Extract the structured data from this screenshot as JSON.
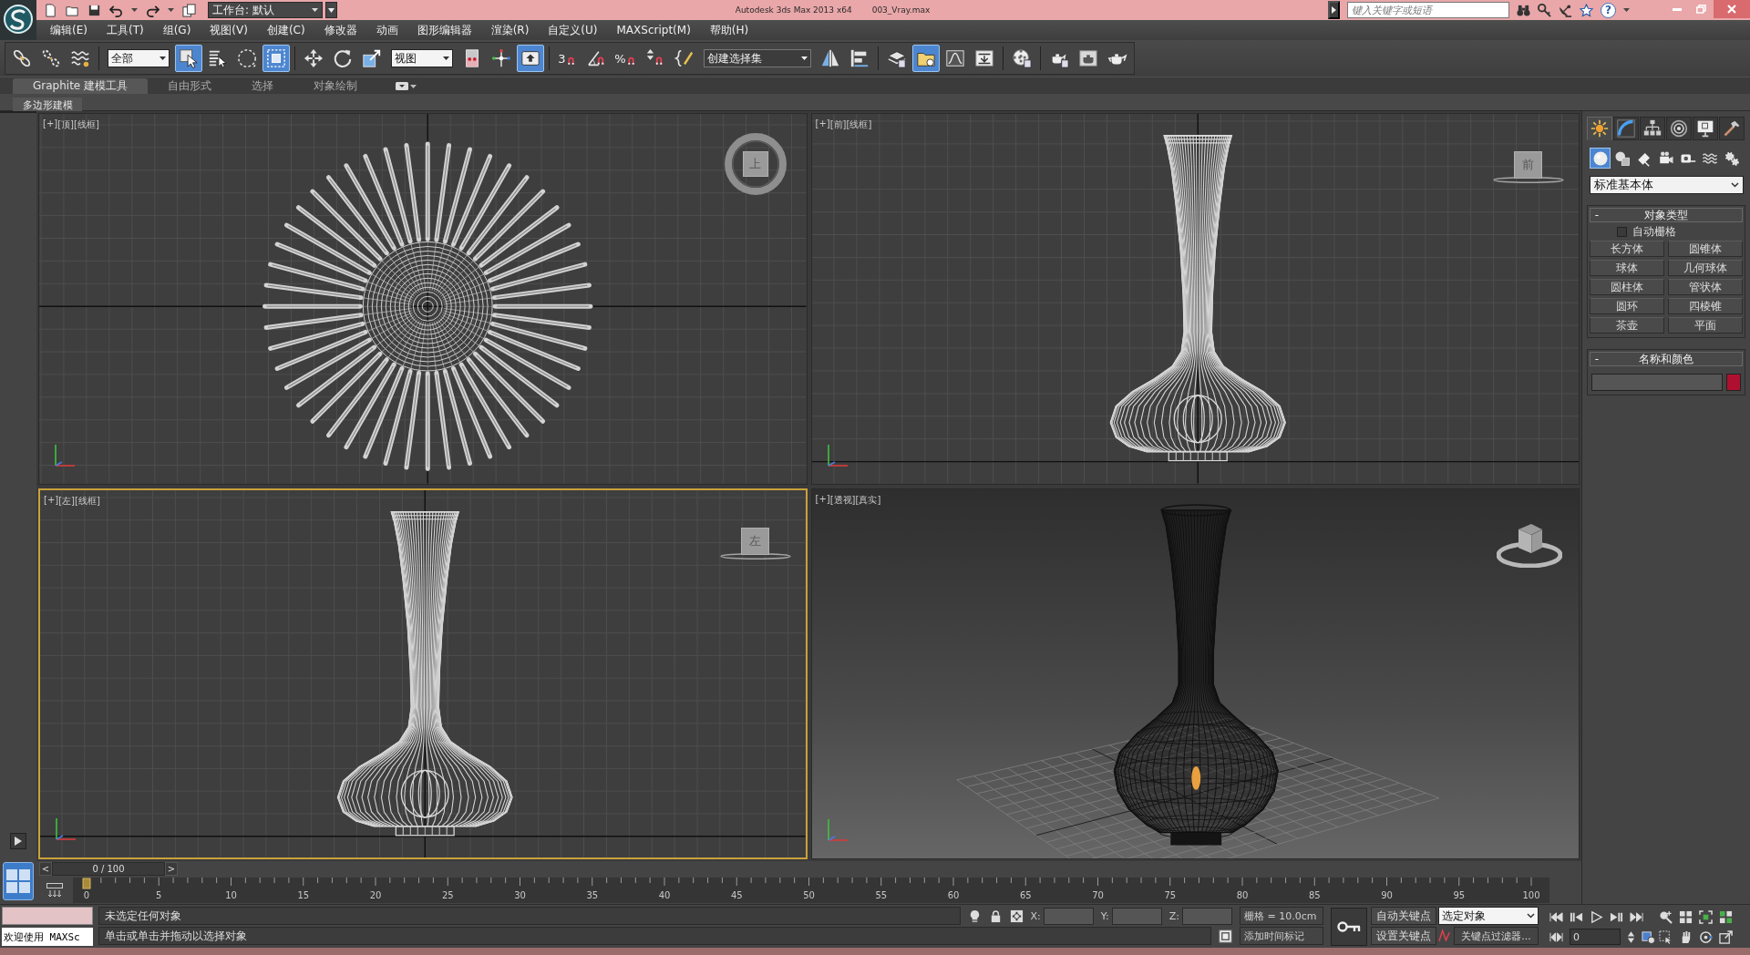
{
  "title_bar": {
    "workspace": "工作台: 默认",
    "title": "Autodesk 3ds Max 2013 x64",
    "file": "003_Vray.max",
    "search": {
      "placeholder": "键入关键字或短语"
    },
    "help": "?"
  },
  "menu_bar": [
    "编辑(E)",
    "工具(T)",
    "组(G)",
    "视图(V)",
    "创建(C)",
    "修改器",
    "动画",
    "图形编辑器",
    "渲染(R)",
    "自定义(U)",
    "MAXScript(M)",
    "帮助(H)"
  ],
  "main_toolbar": [
    {
      "kind": "button",
      "on": false
    },
    {
      "kind": "button",
      "on": false
    },
    {
      "kind": "button",
      "on": false
    },
    {
      "kind": "dropdown",
      "value": "全部"
    },
    {
      "kind": "button",
      "on": true
    },
    {
      "kind": "button",
      "on": false
    },
    {
      "kind": "button",
      "on": false
    },
    {
      "kind": "button",
      "on": true
    },
    {
      "kind": "button",
      "on": false
    },
    {
      "kind": "button",
      "on": false
    },
    {
      "kind": "button",
      "on": false
    },
    {
      "kind": "dropdown",
      "value": "视图"
    },
    {
      "kind": "button",
      "on": false
    },
    {
      "kind": "button",
      "on": false
    },
    {
      "kind": "button",
      "on": true
    },
    {
      "kind": "button",
      "on": false,
      "label": "3"
    },
    {
      "kind": "button",
      "on": false
    },
    {
      "kind": "button",
      "on": false,
      "label": "%"
    },
    {
      "kind": "button",
      "on": false
    },
    {
      "kind": "button",
      "on": false
    },
    {
      "kind": "combo",
      "value": "创建选择集"
    },
    {
      "kind": "button",
      "on": false
    },
    {
      "kind": "button",
      "on": false
    },
    {
      "kind": "button",
      "on": false
    },
    {
      "kind": "button",
      "on": true
    },
    {
      "kind": "button",
      "on": false
    },
    {
      "kind": "button",
      "on": false
    },
    {
      "kind": "button",
      "on": false
    },
    {
      "kind": "button",
      "on": false
    },
    {
      "kind": "button",
      "on": false
    },
    {
      "kind": "button",
      "on": false
    }
  ],
  "ribbon": {
    "tabs": [
      {
        "label": "Graphite 建模工具",
        "selected": true
      },
      {
        "label": "自由形式",
        "selected": false
      },
      {
        "label": "选择",
        "selected": false
      },
      {
        "label": "对象绘制",
        "selected": false
      }
    ],
    "panel": "多边形建模"
  },
  "viewports": [
    {
      "kind": "plan",
      "selected": false,
      "menu": "[+]",
      "view": "[顶]",
      "shading": "[线框]",
      "cube_label": "上"
    },
    {
      "kind": "elevation",
      "selected": false,
      "menu": "[+]",
      "view": "[前]",
      "shading": "[线框]",
      "cube_label": "前"
    },
    {
      "kind": "elevation",
      "selected": true,
      "menu": "[+]",
      "view": "[左]",
      "shading": "[线框]",
      "cube_label": "左"
    },
    {
      "kind": "perspective",
      "selected": false,
      "menu": "[+]",
      "view": "[透视]",
      "shading": "[真实]"
    }
  ],
  "command_panel": {
    "tabs": [
      {
        "selected": true
      },
      {
        "selected": false
      },
      {
        "selected": false
      },
      {
        "selected": false
      },
      {
        "selected": false
      },
      {
        "selected": false
      }
    ],
    "categories": [
      {
        "selected": true
      },
      {
        "selected": false
      },
      {
        "selected": false
      },
      {
        "selected": false
      },
      {
        "selected": false
      },
      {
        "selected": false
      },
      {
        "selected": false
      }
    ],
    "dropdown": {
      "value": "标准基本体"
    },
    "object_type": {
      "toggle": "-",
      "title": "对象类型",
      "autogrid": {
        "label": "自动栅格",
        "checked": false
      },
      "buttons": [
        "长方体",
        "圆锥体",
        "球体",
        "几何球体",
        "圆柱体",
        "管状体",
        "圆环",
        "四棱锥",
        "茶壶",
        "平面"
      ]
    },
    "name_and_color": {
      "toggle": "-",
      "title": "名称和颜色",
      "color": "#b01030"
    }
  },
  "time_slider": {
    "prev": "<",
    "position": "0 / 100",
    "next": ">"
  },
  "track_bar": {
    "labels": [
      "0",
      "5",
      "10",
      "15",
      "20",
      "25",
      "30",
      "35",
      "40",
      "45",
      "50",
      "55",
      "60",
      "65",
      "70",
      "75",
      "80",
      "85",
      "90",
      "95",
      "100"
    ]
  },
  "status_bar": {
    "listener_output": "欢迎使用 MAXSc",
    "selection": "未选定任何对象",
    "prompt": "单击或单击并拖动以选择对象",
    "x_label": "X:",
    "y_label": "Y:",
    "z_label": "Z:",
    "grid": "栅格 = 10.0cm",
    "add_time_tag": "添加时间标记",
    "auto_key": {
      "label": "自动关键点",
      "on": false
    },
    "set_key": "设置关键点",
    "key_set": "选定对象",
    "key_filters": "关键点过滤器...",
    "frame": "0"
  }
}
